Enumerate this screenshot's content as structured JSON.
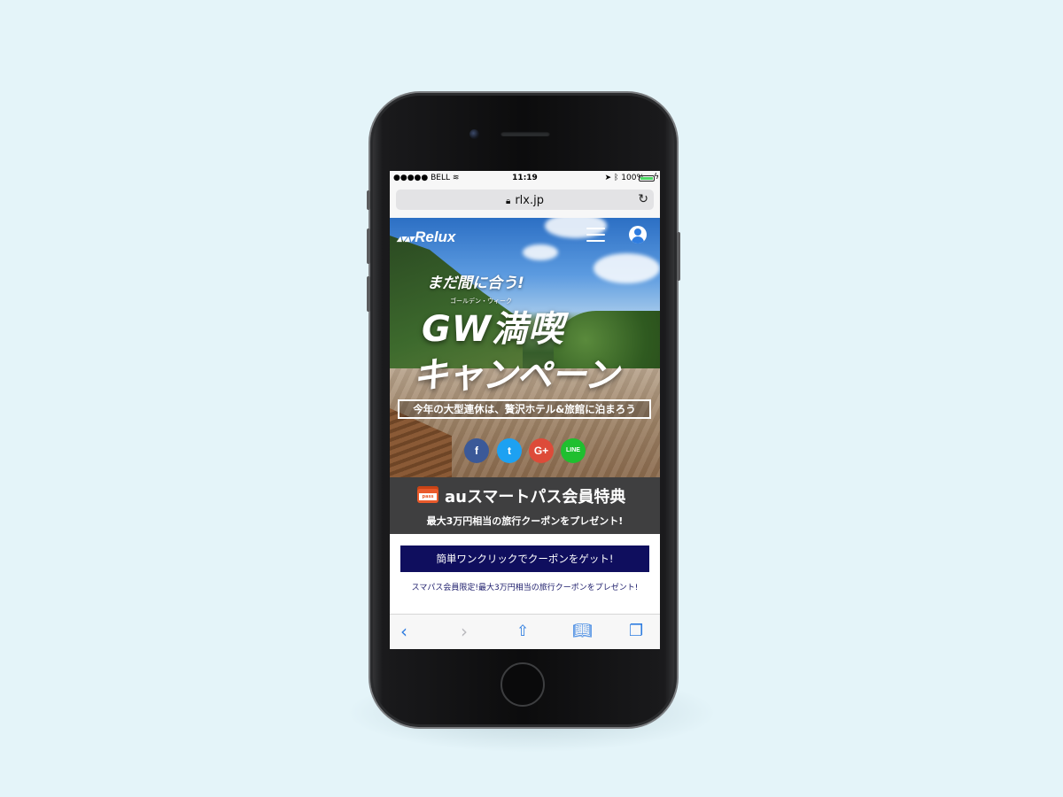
{
  "status_bar": {
    "carrier": "●●●●● BELL",
    "time": "11:19",
    "battery": "100%",
    "battery_level": 1.0
  },
  "browser": {
    "url": "rlx.jp"
  },
  "site": {
    "logo": "Relux"
  },
  "hero": {
    "tagline": "まだ間に合う!",
    "ruby": "ゴールデン・ウィーク",
    "title_line1": "GW満喫",
    "title_line2": "キャンペーン",
    "subtitle": "今年の大型連休は、贅沢ホテル&旅館に泊まろう",
    "social": [
      {
        "label": "f",
        "color": "#3b5998",
        "icon": "facebook-icon"
      },
      {
        "label": "t",
        "color": "#1da1f2",
        "icon": "twitter-icon"
      },
      {
        "label": "G+",
        "color": "#dd4b39",
        "icon": "google-plus-icon"
      },
      {
        "label": "LINE",
        "color": "#1fbf2f",
        "icon": "line-icon"
      }
    ]
  },
  "promo": {
    "card_text": "pass",
    "title": "auスマートパス会員特典",
    "subtitle": "最大3万円相当の旅行クーポンをプレゼント!"
  },
  "cta": {
    "button_label": "簡単ワンクリックでクーポンをゲット!",
    "note": "スマパス会員限定!最大3万円相当の旅行クーポンをプレゼント!"
  },
  "colors": {
    "page_bg": "#e4f4f9",
    "cta_bg": "#0f0e5e",
    "promo_bg": "#3f3f40",
    "ios_blue": "#2f7de0"
  }
}
